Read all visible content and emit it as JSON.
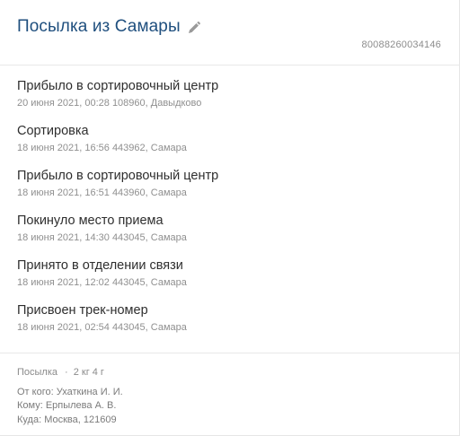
{
  "header": {
    "title": "Посылка из Самары",
    "track_number": "80088260034146"
  },
  "events": [
    {
      "status": "Прибыло в сортировочный центр",
      "meta": "20 июня 2021, 00:28 108960, Давыдково"
    },
    {
      "status": "Сортировка",
      "meta": "18 июня 2021, 16:56 443962, Самара"
    },
    {
      "status": "Прибыло в сортировочный центр",
      "meta": "18 июня 2021, 16:51 443960, Самара"
    },
    {
      "status": "Покинуло место приема",
      "meta": "18 июня 2021, 14:30 443045, Самара"
    },
    {
      "status": "Принято в отделении связи",
      "meta": "18 июня 2021, 12:02 443045, Самара"
    },
    {
      "status": "Присвоен трек-номер",
      "meta": "18 июня 2021, 02:54 443045, Самара"
    }
  ],
  "footer": {
    "type": "Посылка",
    "dot": "·",
    "weight": "2 кг 4 г",
    "from": "От кого: Ухаткина И. И.",
    "to": "Кому: Ерпылева А. В.",
    "dest": "Куда: Москва, 121609"
  },
  "icons": {
    "edit": "pencil-icon"
  },
  "colors": {
    "title": "#1f4f7e",
    "meta": "#8f8f8f"
  }
}
